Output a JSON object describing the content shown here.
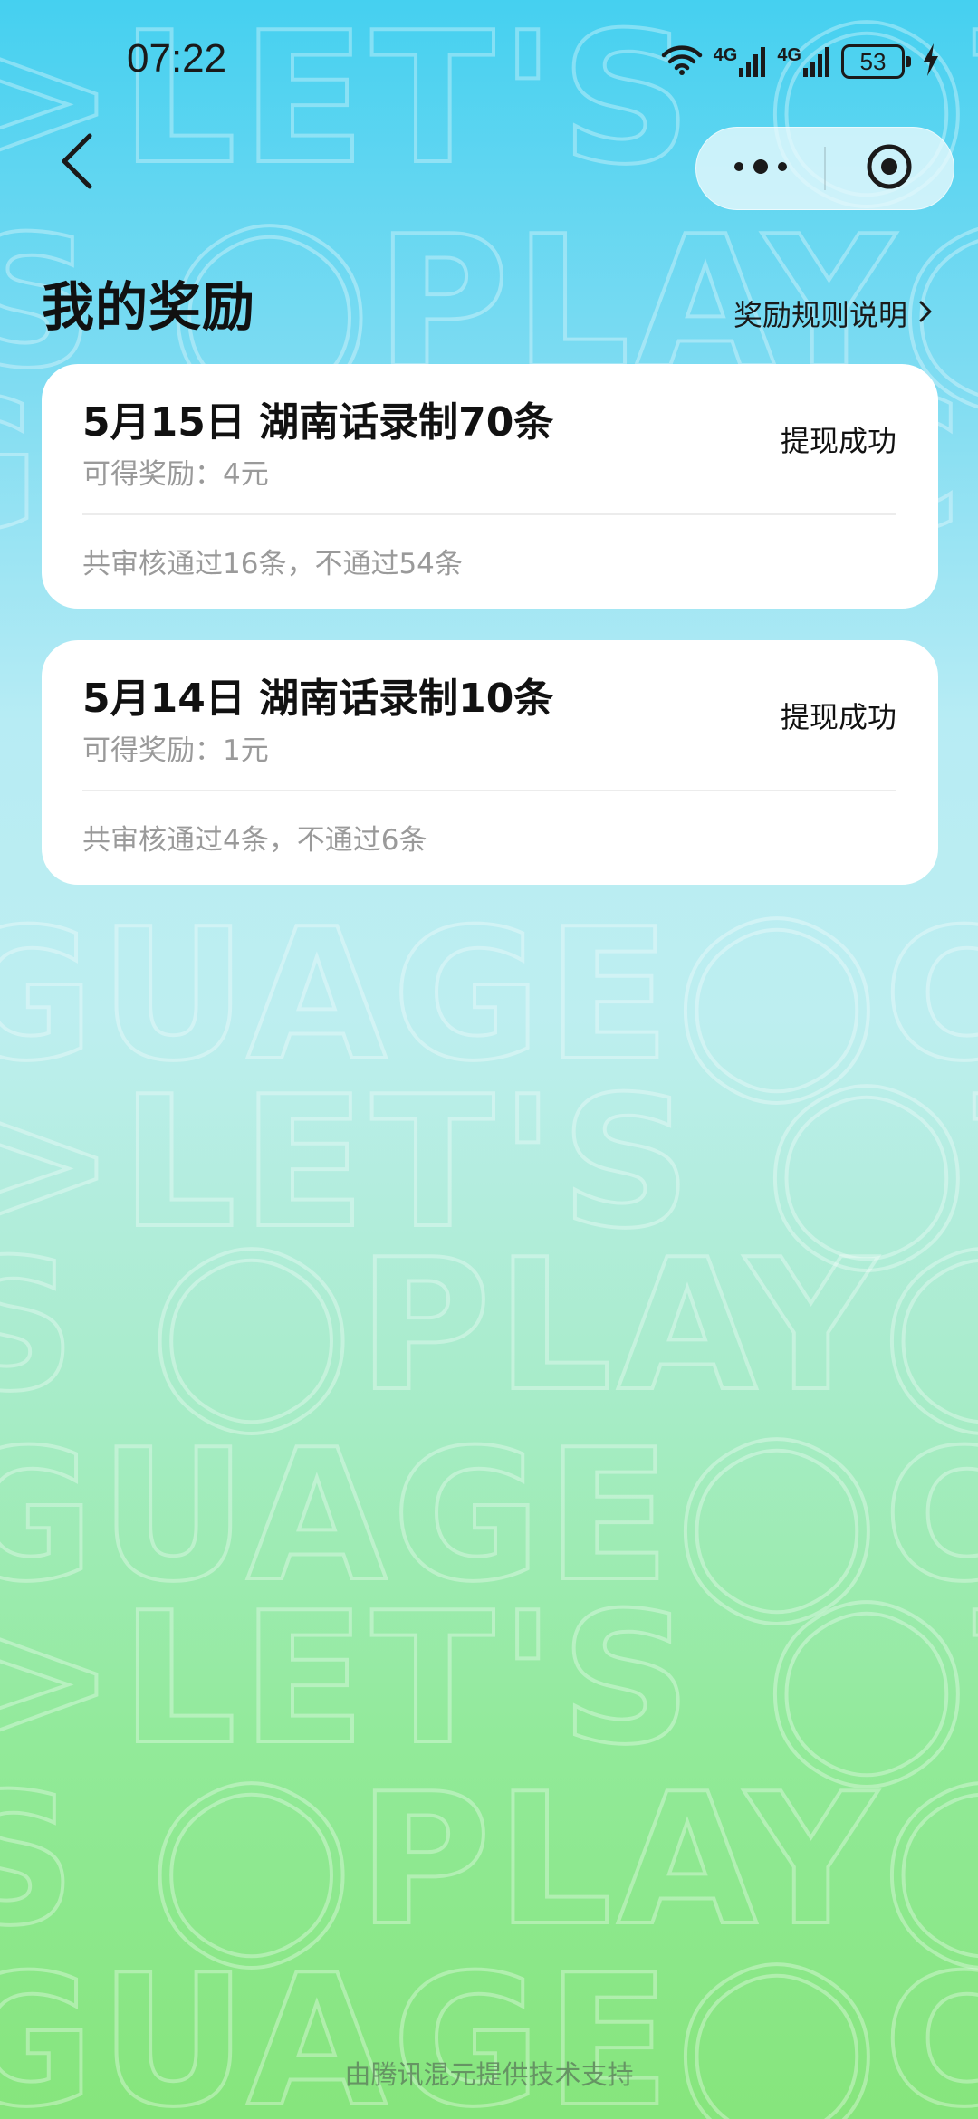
{
  "status_bar": {
    "time": "07:22",
    "network_1": "4G",
    "network_2": "4G",
    "battery": "53",
    "icons": [
      "wifi-icon",
      "signal-icon",
      "battery-icon",
      "charging-icon"
    ]
  },
  "nav": {
    "back_icon": "chevron-left-icon",
    "more_icon": "more-dots-icon",
    "close_icon": "target-circle-icon"
  },
  "header": {
    "title": "我的奖励",
    "rules_link": "奖励规则说明"
  },
  "rewards": [
    {
      "title": "5月15日 湖南话录制70条",
      "reward": "可得奖励：4元",
      "status": "提现成功",
      "summary": "共审核通过16条，不通过54条"
    },
    {
      "title": "5月14日 湖南话录制10条",
      "reward": "可得奖励：1元",
      "status": "提现成功",
      "summary": "共审核通过4条，不通过6条"
    }
  ],
  "footer": {
    "text": "由腾讯混元提供技术支持"
  },
  "colors": {
    "gradient_top": "#45d0f0",
    "gradient_middle": "#bdeef0",
    "gradient_bottom": "#86e57c",
    "card_bg": "#ffffff",
    "muted_text": "#9a9a9a"
  }
}
